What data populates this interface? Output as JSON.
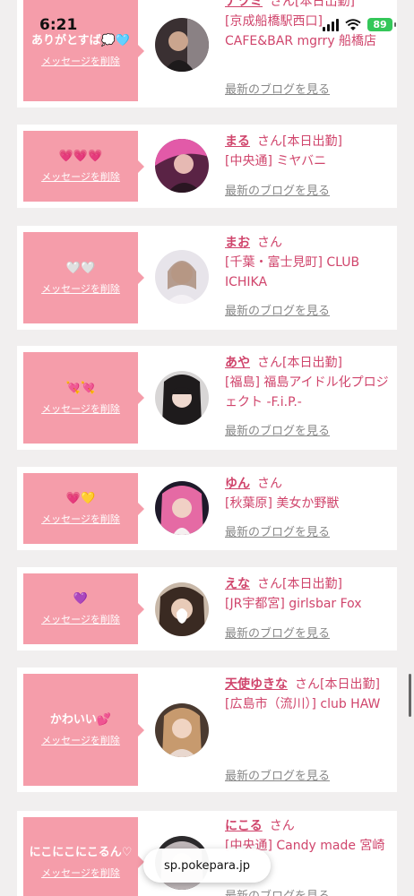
{
  "status": {
    "time": "6:21",
    "battery": "89"
  },
  "browser": {
    "url": "sp.pokepara.jp"
  },
  "colors": {
    "accent": "#d0456c",
    "bubble": "#f59daa",
    "background": "#f1efef"
  },
  "entries": [
    {
      "name": "ナツミ",
      "san": "さん",
      "tag": "[本日出勤]",
      "shop": "[京成船橋駅西口] CAFE&BAR mgrry 船橋店",
      "message": "ありがとすば💭🩵",
      "delete": "メッセージを削除",
      "blog": "最新のブログを見る"
    },
    {
      "name": "まる",
      "san": "さん",
      "tag": "[本日出勤]",
      "shop": "[中央通] ミヤバニ",
      "message": "💗💗💗",
      "delete": "メッセージを削除",
      "blog": "最新のブログを見る"
    },
    {
      "name": "まお",
      "san": "さん",
      "tag": "",
      "shop": "[千葉・富士見町] CLUB ICHIKA",
      "message": "🤍🤍",
      "delete": "メッセージを削除",
      "blog": "最新のブログを見る"
    },
    {
      "name": "あや",
      "san": "さん",
      "tag": "[本日出勤]",
      "shop": "[福島] 福島アイドル化プロジェクト -F.i.P.-",
      "message": "💘💘",
      "delete": "メッセージを削除",
      "blog": "最新のブログを見る"
    },
    {
      "name": "ゆん",
      "san": "さん",
      "tag": "",
      "shop": "[秋葉原] 美女か野獣",
      "message": "💗💛",
      "delete": "メッセージを削除",
      "blog": "最新のブログを見る"
    },
    {
      "name": "えな",
      "san": "さん",
      "tag": "[本日出勤]",
      "shop": "[JR宇都宮] girlsbar Fox",
      "message": "💜",
      "delete": "メッセージを削除",
      "blog": "最新のブログを見る"
    },
    {
      "name": "天使ゆきな",
      "san": "さん",
      "tag": "[本日出勤]",
      "shop": "[広島市（流川）] club HAW",
      "message": "かわいい💕",
      "delete": "メッセージを削除",
      "blog": "最新のブログを見る"
    },
    {
      "name": "にこる",
      "san": "さん",
      "tag": "",
      "shop": "[中央通] Candy made 宮崎",
      "message": "にこにこにこるん♡",
      "delete": "メッセージを削除",
      "blog": "最新のブログを見る"
    }
  ]
}
